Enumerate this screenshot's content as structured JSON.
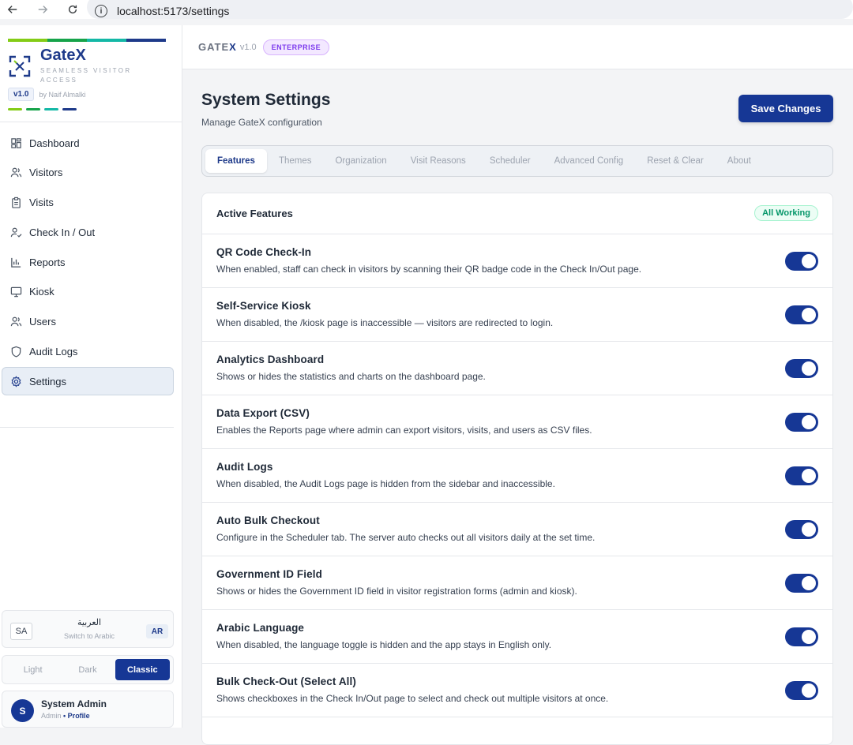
{
  "browser": {
    "url": "localhost:5173/settings"
  },
  "sidebar": {
    "brand_name": "GateX",
    "tagline": "SEAMLESS VISITOR ACCESS",
    "version": "v1.0",
    "author": "by Naif Almalki",
    "items": [
      {
        "label": "Dashboard",
        "icon": "dashboard-icon",
        "active": false
      },
      {
        "label": "Visitors",
        "icon": "users-icon",
        "active": false
      },
      {
        "label": "Visits",
        "icon": "clipboard-icon",
        "active": false
      },
      {
        "label": "Check In / Out",
        "icon": "user-check-icon",
        "active": false
      },
      {
        "label": "Reports",
        "icon": "bar-chart-icon",
        "active": false
      },
      {
        "label": "Kiosk",
        "icon": "monitor-icon",
        "active": false
      },
      {
        "label": "Users",
        "icon": "users-icon",
        "active": false
      },
      {
        "label": "Audit Logs",
        "icon": "shield-icon",
        "active": false
      },
      {
        "label": "Settings",
        "icon": "gear-icon",
        "active": true
      }
    ],
    "language": {
      "flag": "SA",
      "name": "العربية",
      "switch_label": "Switch to Arabic",
      "code": "AR"
    },
    "themes": [
      {
        "label": "Light",
        "active": false
      },
      {
        "label": "Dark",
        "active": false
      },
      {
        "label": "Classic",
        "active": true
      }
    ],
    "user": {
      "initial": "S",
      "name": "System Admin",
      "role": "Admin",
      "profile_link": "• Profile"
    }
  },
  "topbar": {
    "brand_prefix": "GATE",
    "brand_x": "X",
    "version": "v1.0",
    "edition": "ENTERPRISE"
  },
  "page": {
    "title": "System Settings",
    "subtitle": "Manage GateX configuration",
    "save_label": "Save Changes",
    "tabs": [
      "Features",
      "Themes",
      "Organization",
      "Visit Reasons",
      "Scheduler",
      "Advanced Config",
      "Reset & Clear",
      "About"
    ],
    "active_tab": "Features"
  },
  "features": {
    "title": "Active Features",
    "status": "All Working",
    "items": [
      {
        "name": "QR Code Check-In",
        "desc": "When enabled, staff can check in visitors by scanning their QR badge code in the Check In/Out page.",
        "enabled": true
      },
      {
        "name": "Self-Service Kiosk",
        "desc": "When disabled, the /kiosk page is inaccessible — visitors are redirected to login.",
        "enabled": true
      },
      {
        "name": "Analytics Dashboard",
        "desc": "Shows or hides the statistics and charts on the dashboard page.",
        "enabled": true
      },
      {
        "name": "Data Export (CSV)",
        "desc": "Enables the Reports page where admin can export visitors, visits, and users as CSV files.",
        "enabled": true
      },
      {
        "name": "Audit Logs",
        "desc": "When disabled, the Audit Logs page is hidden from the sidebar and inaccessible.",
        "enabled": true
      },
      {
        "name": "Auto Bulk Checkout",
        "desc": "Configure in the Scheduler tab. The server auto checks out all visitors daily at the set time.",
        "enabled": true
      },
      {
        "name": "Government ID Field",
        "desc": "Shows or hides the Government ID field in visitor registration forms (admin and kiosk).",
        "enabled": true
      },
      {
        "name": "Arabic Language",
        "desc": "When disabled, the language toggle is hidden and the app stays in English only.",
        "enabled": true
      },
      {
        "name": "Bulk Check-Out (Select All)",
        "desc": "Shows checkboxes in the Check In/Out page to select and check out multiple visitors at once.",
        "enabled": true
      }
    ]
  },
  "colors": {
    "primary": "#163795",
    "brand_stripe": [
      "#84cc16",
      "#16a34a",
      "#14b8a6",
      "#1e3a8a"
    ]
  }
}
